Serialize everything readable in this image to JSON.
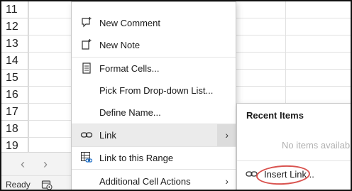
{
  "grid": {
    "row_numbers": [
      "11",
      "12",
      "13",
      "14",
      "15",
      "16",
      "17",
      "18",
      "19"
    ]
  },
  "tabbar": {
    "prev_glyph": "‹",
    "next_glyph": "›"
  },
  "status": {
    "text": "Ready"
  },
  "context_menu": {
    "items": [
      {
        "label": "New Comment",
        "icon": "new-comment-icon"
      },
      {
        "label": "New Note",
        "icon": "new-note-icon"
      },
      {
        "label": "Format Cells...",
        "icon": "format-cells-icon"
      },
      {
        "label": "Pick From Drop-down List...",
        "icon": ""
      },
      {
        "label": "Define Name...",
        "icon": ""
      },
      {
        "label": "Link",
        "icon": "link-icon",
        "has_submenu": true
      },
      {
        "label": "Link to this Range",
        "icon": "link-range-icon"
      },
      {
        "label": "Additional Cell Actions",
        "icon": "",
        "has_submenu": true
      }
    ]
  },
  "submenu": {
    "title": "Recent Items",
    "empty_text": "No items available",
    "insert_label": "Insert Link...",
    "annotation_color": "#d9534f"
  }
}
